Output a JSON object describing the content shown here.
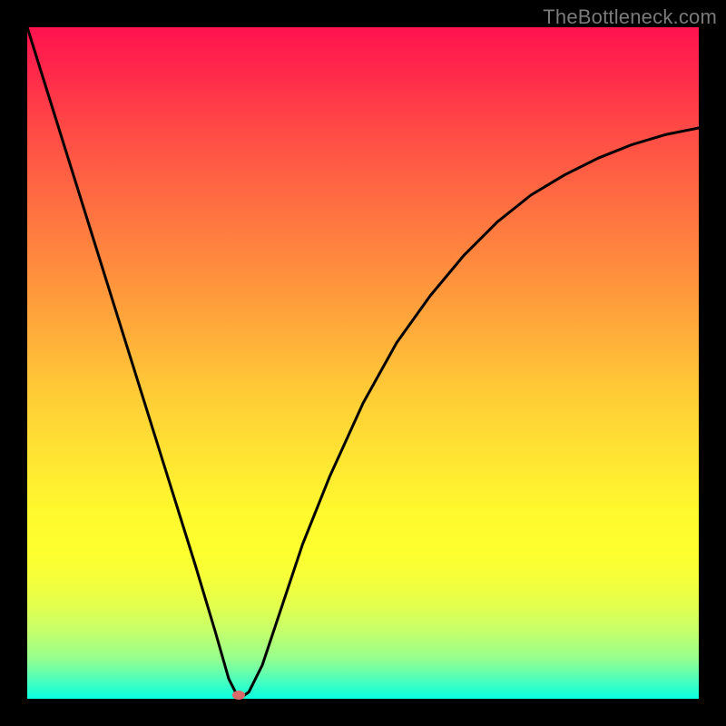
{
  "watermark": "TheBottleneck.com",
  "colors": {
    "background": "#000000",
    "gradient_top": "#ff134e",
    "gradient_bottom": "#08ffe0",
    "curve_stroke": "#000000",
    "marker_fill": "#d96a6a"
  },
  "chart_data": {
    "type": "line",
    "title": "",
    "xlabel": "",
    "ylabel": "",
    "xlim": [
      0,
      100
    ],
    "ylim": [
      0,
      100
    ],
    "x": [
      0,
      5,
      10,
      15,
      20,
      25,
      28,
      30,
      31,
      32,
      33,
      35,
      38,
      41,
      45,
      50,
      55,
      60,
      65,
      70,
      75,
      80,
      85,
      90,
      95,
      100
    ],
    "values": [
      100,
      84,
      68,
      52,
      36,
      20,
      10,
      3,
      1,
      0.3,
      1,
      5,
      14,
      23,
      33,
      44,
      53,
      60,
      66,
      71,
      75,
      78,
      80.5,
      82.5,
      84,
      85
    ],
    "series": [
      {
        "name": "bottleneck-curve",
        "x": [
          0,
          5,
          10,
          15,
          20,
          25,
          28,
          30,
          31,
          32,
          33,
          35,
          38,
          41,
          45,
          50,
          55,
          60,
          65,
          70,
          75,
          80,
          85,
          90,
          95,
          100
        ],
        "values": [
          100,
          84,
          68,
          52,
          36,
          20,
          10,
          3,
          1,
          0.3,
          1,
          5,
          14,
          23,
          33,
          44,
          53,
          60,
          66,
          71,
          75,
          78,
          80.5,
          82.5,
          84,
          85
        ]
      }
    ],
    "marker": {
      "x": 31.5,
      "y": 0.5
    }
  }
}
